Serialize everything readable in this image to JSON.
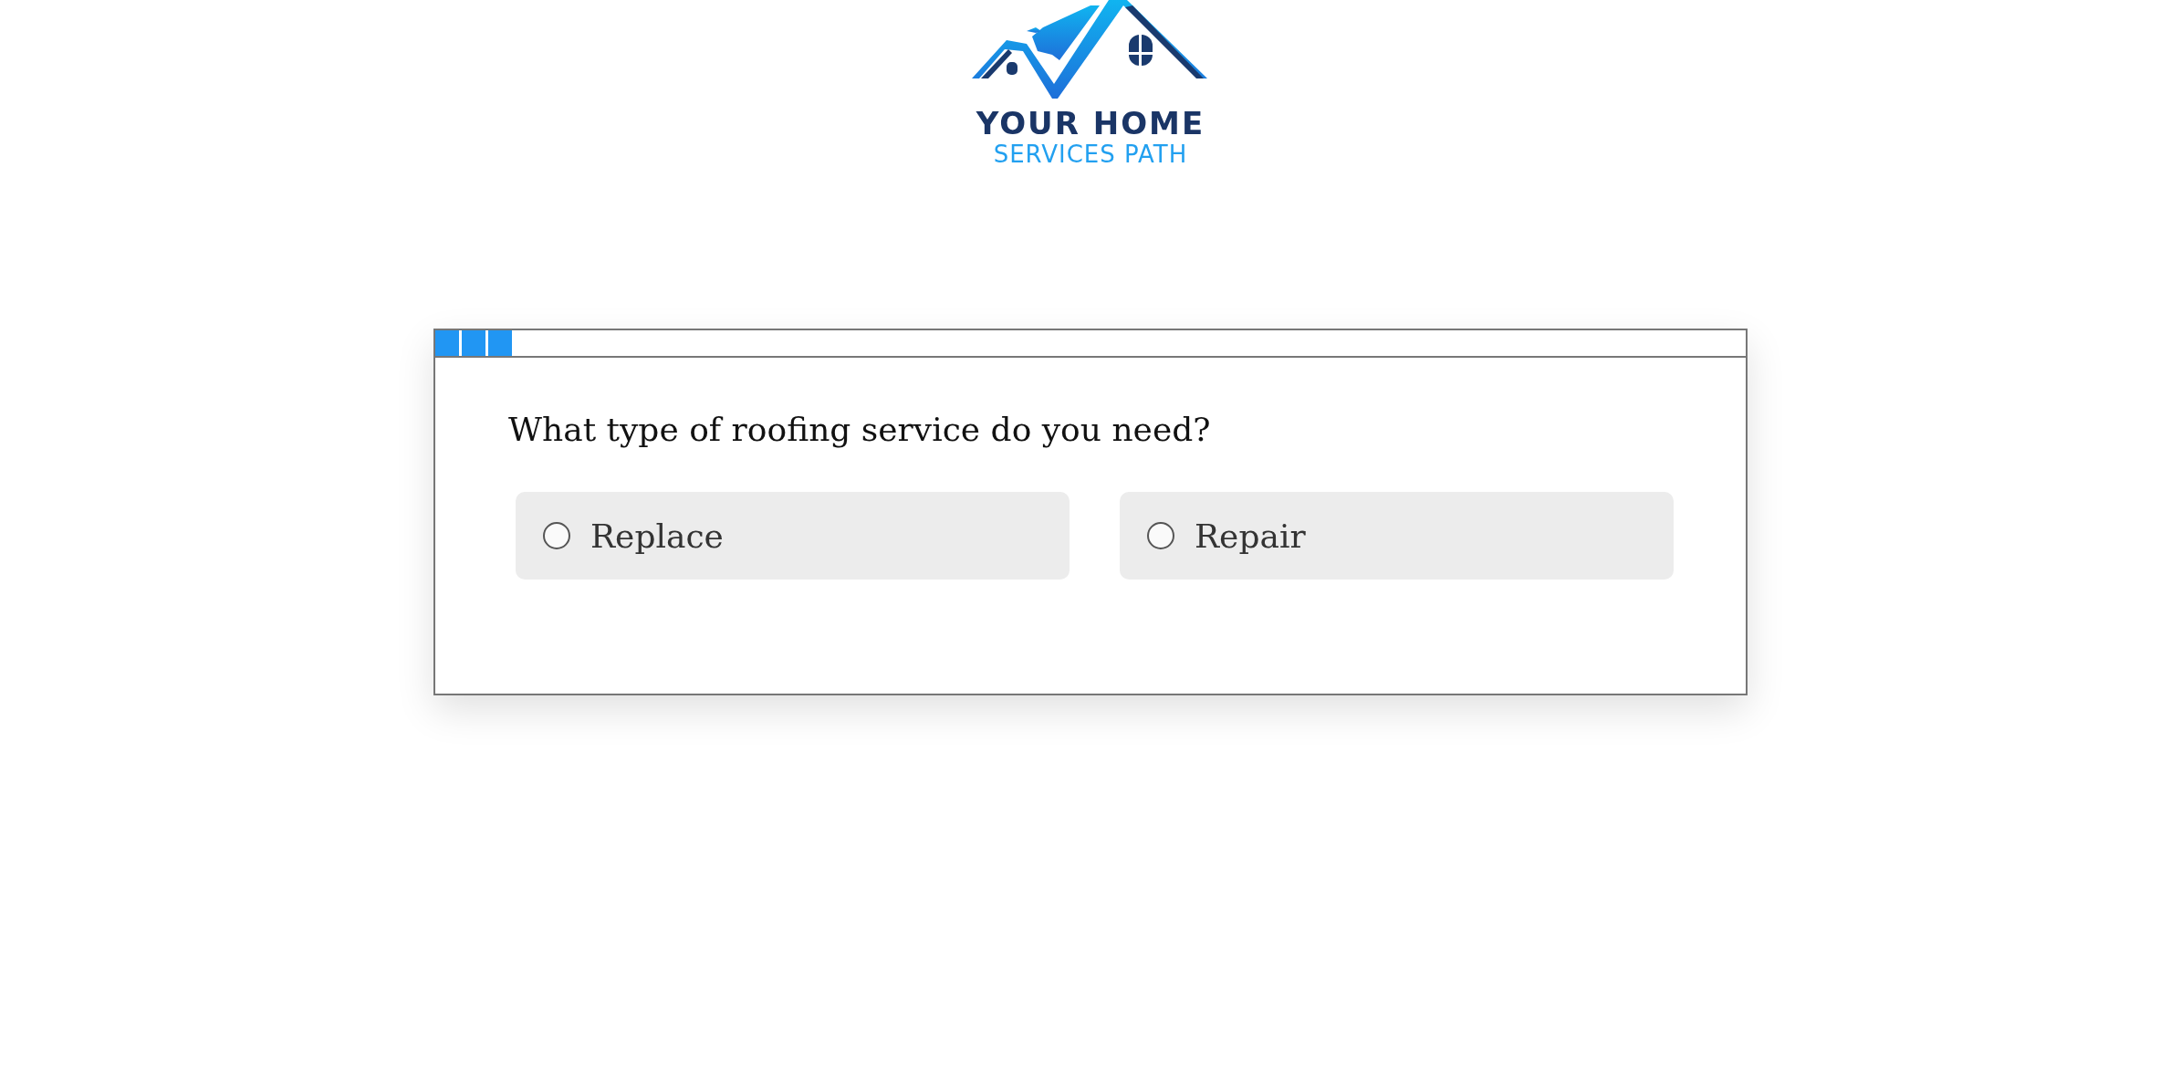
{
  "logo": {
    "line_1": "YOUR HOME",
    "line_2": "SERVICES PATH"
  },
  "progress": {
    "level": 0.06
  },
  "question": "What type of roofing service do you need?",
  "options": [
    {
      "label": "Replace",
      "selected": false
    },
    {
      "label": "Repair",
      "selected": false
    }
  ]
}
